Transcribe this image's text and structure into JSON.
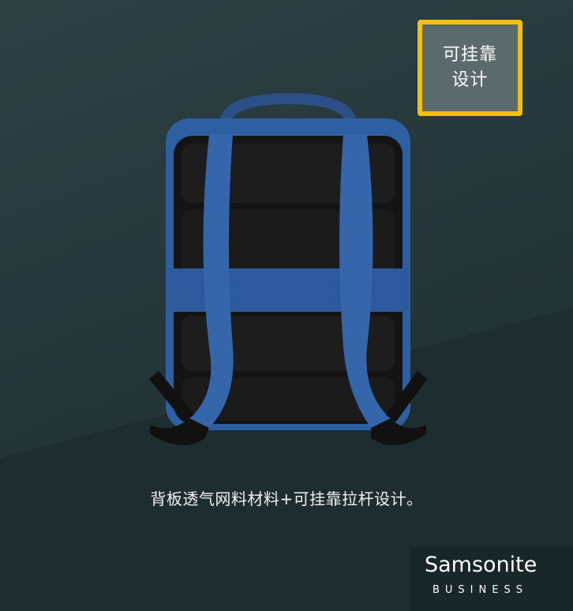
{
  "tag": {
    "line1": "可挂靠",
    "line2": "设计"
  },
  "caption": "背板透气网料材料+可挂靠拉杆设计。",
  "logo": {
    "wordmark": "Samsonite",
    "sub": "BUSINESS"
  },
  "colors": {
    "background": "#26383b",
    "tag_border": "#f2bf0d",
    "bag_blue": "#2f5fa3",
    "back_panel": "#141414"
  }
}
